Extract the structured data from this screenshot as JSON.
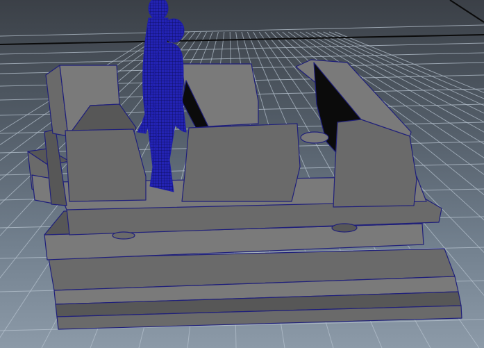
{
  "viewport": {
    "camera": "perspective",
    "display_mode": "wireframe-on-shaded",
    "grid_visible": true
  },
  "colors": {
    "background_top": "#3b4047",
    "background_bottom": "#8c9aa8",
    "grid_line": "#b7c3cf",
    "grid_axis": "#0a0a0a",
    "mesh_face": "#6a6a6a",
    "mesh_face_light": "#7a7a7a",
    "mesh_face_dark": "#575757",
    "mesh_edge": "#1f1f7a",
    "void": "#0b0b0b",
    "figure_wire": "#1e1ea8"
  },
  "objects": [
    {
      "name": "ride-platform",
      "type": "polygon-mesh"
    },
    {
      "name": "human-figure-back",
      "type": "polygon-mesh"
    },
    {
      "name": "human-figure-front",
      "type": "polygon-mesh"
    }
  ]
}
